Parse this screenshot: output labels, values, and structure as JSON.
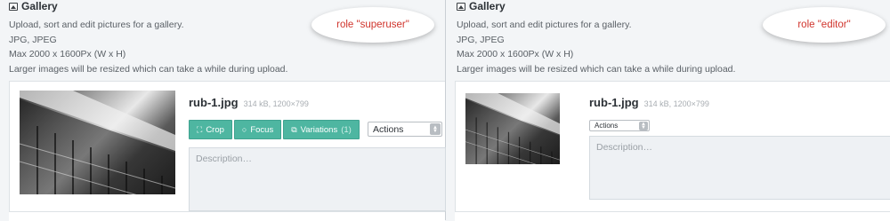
{
  "panels": [
    {
      "gallery_title": "Gallery",
      "description_lines": [
        "Upload, sort and edit pictures for a gallery.",
        "JPG, JPEG",
        "Max 2000 x 1600Px (W x H)",
        "Larger images will be resized which can take a while during upload."
      ],
      "role_label": "role \"superuser\"",
      "file": {
        "name": "rub-1.jpg",
        "meta": "314 kB, 1200×799"
      },
      "buttons": {
        "crop": "Crop",
        "focus": "Focus",
        "variations": "Variations",
        "variations_count": "(1)"
      },
      "actions_select": "Actions",
      "description_placeholder": "Description…"
    },
    {
      "gallery_title": "Gallery",
      "description_lines": [
        "Upload, sort and edit pictures for a gallery.",
        "JPG, JPEG",
        "Max 2000 x 1600Px (W x H)",
        "Larger images will be resized which can take a while during upload."
      ],
      "role_label": "role \"editor\"",
      "file": {
        "name": "rub-1.jpg",
        "meta": "314 kB, 1200×799"
      },
      "actions_select": "Actions",
      "description_placeholder": "Description…"
    }
  ],
  "colors": {
    "button": "#4eb6a1",
    "role_text": "#d0342c"
  },
  "icons": {
    "gallery": "image-icon",
    "crop": "crop-icon",
    "focus": "circle-icon",
    "variations": "copy-icon",
    "select": "updown-arrows-icon"
  }
}
